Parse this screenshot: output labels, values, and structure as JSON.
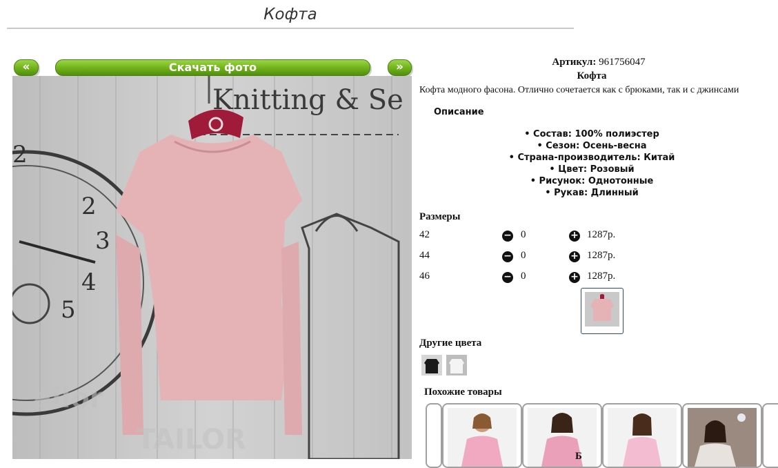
{
  "header": {
    "title": "Кофта"
  },
  "gallery": {
    "prev_label": "«",
    "download_label": "Скачать фото",
    "next_label": "»"
  },
  "product": {
    "article_label": "Артикул:",
    "article_value": "961756047",
    "name": "Кофта",
    "description": "Кофта модного фасона. Отлично сочетается как с брюками, так и с джинсами",
    "description_heading": "Описание",
    "attributes": [
      "Состав: 100% полиэстер",
      "Сезон: Осень-весна",
      "Страна-производитель: Китай",
      "Цвет: Розовый",
      "Рисунок: Однотонные",
      "Рукав: Длинный"
    ]
  },
  "sizes": {
    "heading": "Размеры",
    "rows": [
      {
        "size": "42",
        "qty": "0",
        "price": "1287р."
      },
      {
        "size": "44",
        "qty": "0",
        "price": "1287р."
      },
      {
        "size": "46",
        "qty": "0",
        "price": "1287р."
      }
    ]
  },
  "other_colors": {
    "heading": "Другие цвета"
  },
  "similar": {
    "heading": "Похожие товары",
    "cut_text": "Б"
  },
  "icons": {
    "minus": "minus-circle-icon",
    "plus": "plus-circle-icon"
  },
  "colors": {
    "accent_green": "#77b81e",
    "sweater_pink": "#e5b2b5",
    "hanger": "#a01a3a"
  }
}
